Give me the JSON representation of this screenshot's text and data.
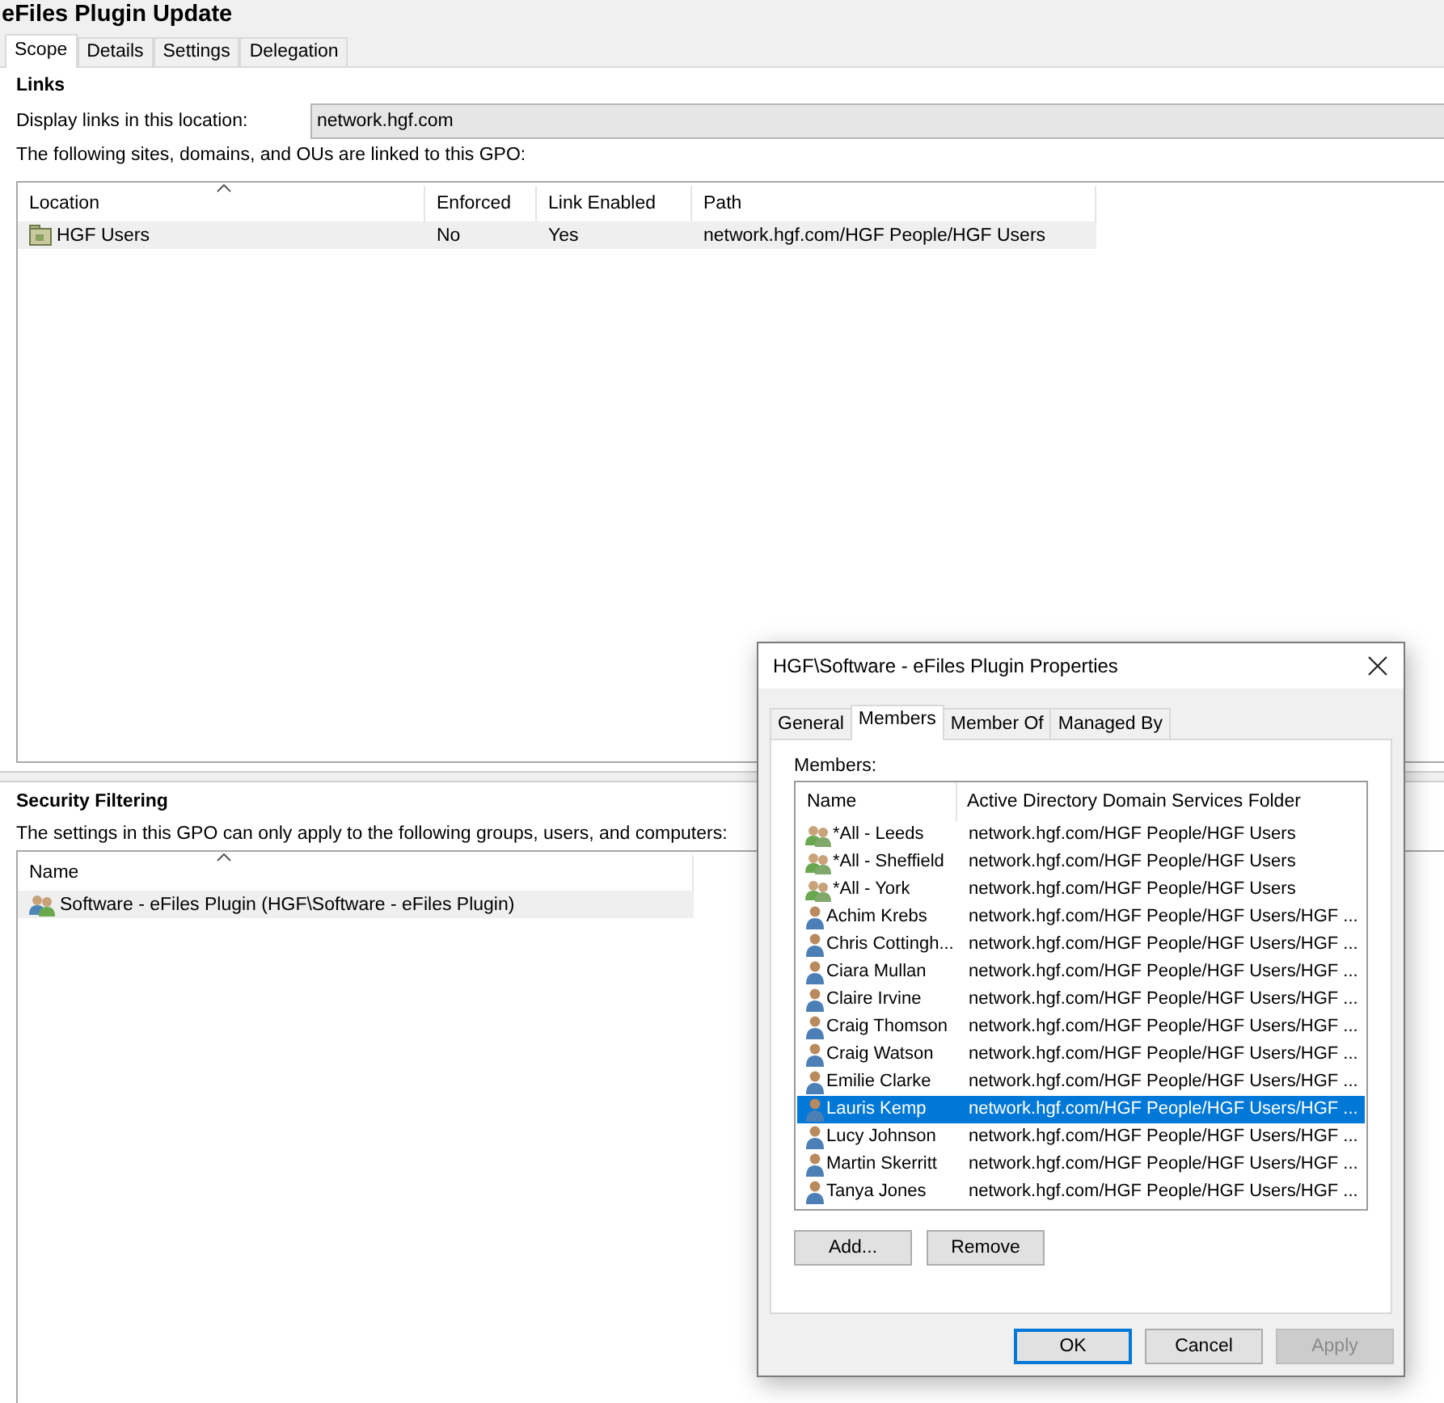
{
  "window": {
    "title": "eFiles Plugin Update"
  },
  "tabs": [
    {
      "label": "Scope",
      "selected": true
    },
    {
      "label": "Details",
      "selected": false
    },
    {
      "label": "Settings",
      "selected": false
    },
    {
      "label": "Delegation",
      "selected": false
    }
  ],
  "links": {
    "heading": "Links",
    "location_label": "Display links in this location:",
    "location_value": "network.hgf.com",
    "caption": "The following sites, domains, and OUs are linked to this GPO:",
    "columns": [
      "Location",
      "Enforced",
      "Link Enabled",
      "Path"
    ],
    "rows": [
      {
        "location": "HGF Users",
        "enforced": "No",
        "link_enabled": "Yes",
        "path": "network.hgf.com/HGF People/HGF Users",
        "selected": true
      }
    ]
  },
  "security_filtering": {
    "heading": "Security Filtering",
    "caption": "The settings in this GPO can only apply to the following groups, users, and computers:",
    "columns": [
      "Name"
    ],
    "rows": [
      {
        "name": "Software - eFiles Plugin (HGF\\Software - eFiles Plugin)",
        "selected": true
      }
    ]
  },
  "dialog": {
    "title": "HGF\\Software - eFiles Plugin Properties",
    "tabs": [
      {
        "label": "General",
        "selected": false
      },
      {
        "label": "Members",
        "selected": true
      },
      {
        "label": "Member Of",
        "selected": false
      },
      {
        "label": "Managed By",
        "selected": false
      }
    ],
    "members_label": "Members:",
    "columns": [
      "Name",
      "Active Directory Domain Services Folder"
    ],
    "members": [
      {
        "kind": "group",
        "name": "*All - Leeds",
        "folder": "network.hgf.com/HGF People/HGF Users",
        "selected": false
      },
      {
        "kind": "group",
        "name": "*All - Sheffield",
        "folder": "network.hgf.com/HGF People/HGF Users",
        "selected": false
      },
      {
        "kind": "group",
        "name": "*All - York",
        "folder": "network.hgf.com/HGF People/HGF Users",
        "selected": false
      },
      {
        "kind": "user",
        "name": "Achim Krebs",
        "folder": "network.hgf.com/HGF People/HGF Users/HGF ...",
        "selected": false
      },
      {
        "kind": "user",
        "name": "Chris Cottingh...",
        "folder": "network.hgf.com/HGF People/HGF Users/HGF ...",
        "selected": false
      },
      {
        "kind": "user",
        "name": "Ciara Mullan",
        "folder": "network.hgf.com/HGF People/HGF Users/HGF ...",
        "selected": false
      },
      {
        "kind": "user",
        "name": "Claire Irvine",
        "folder": "network.hgf.com/HGF People/HGF Users/HGF ...",
        "selected": false
      },
      {
        "kind": "user",
        "name": "Craig Thomson",
        "folder": "network.hgf.com/HGF People/HGF Users/HGF ...",
        "selected": false
      },
      {
        "kind": "user",
        "name": "Craig Watson",
        "folder": "network.hgf.com/HGF People/HGF Users/HGF ...",
        "selected": false
      },
      {
        "kind": "user",
        "name": "Emilie Clarke",
        "folder": "network.hgf.com/HGF People/HGF Users/HGF ...",
        "selected": false
      },
      {
        "kind": "user",
        "name": "Lauris Kemp",
        "folder": "network.hgf.com/HGF People/HGF Users/HGF ...",
        "selected": true
      },
      {
        "kind": "user",
        "name": "Lucy Johnson",
        "folder": "network.hgf.com/HGF People/HGF Users/HGF ...",
        "selected": false
      },
      {
        "kind": "user",
        "name": "Martin Skerritt",
        "folder": "network.hgf.com/HGF People/HGF Users/HGF ...",
        "selected": false
      },
      {
        "kind": "user",
        "name": "Tanya Jones",
        "folder": "network.hgf.com/HGF People/HGF Users/HGF ...",
        "selected": false
      }
    ],
    "list_buttons": [
      "Add...",
      "Remove"
    ],
    "footer_buttons": [
      {
        "label": "OK",
        "default": true,
        "disabled": false
      },
      {
        "label": "Cancel",
        "default": false,
        "disabled": false
      },
      {
        "label": "Apply",
        "default": false,
        "disabled": true
      }
    ]
  }
}
